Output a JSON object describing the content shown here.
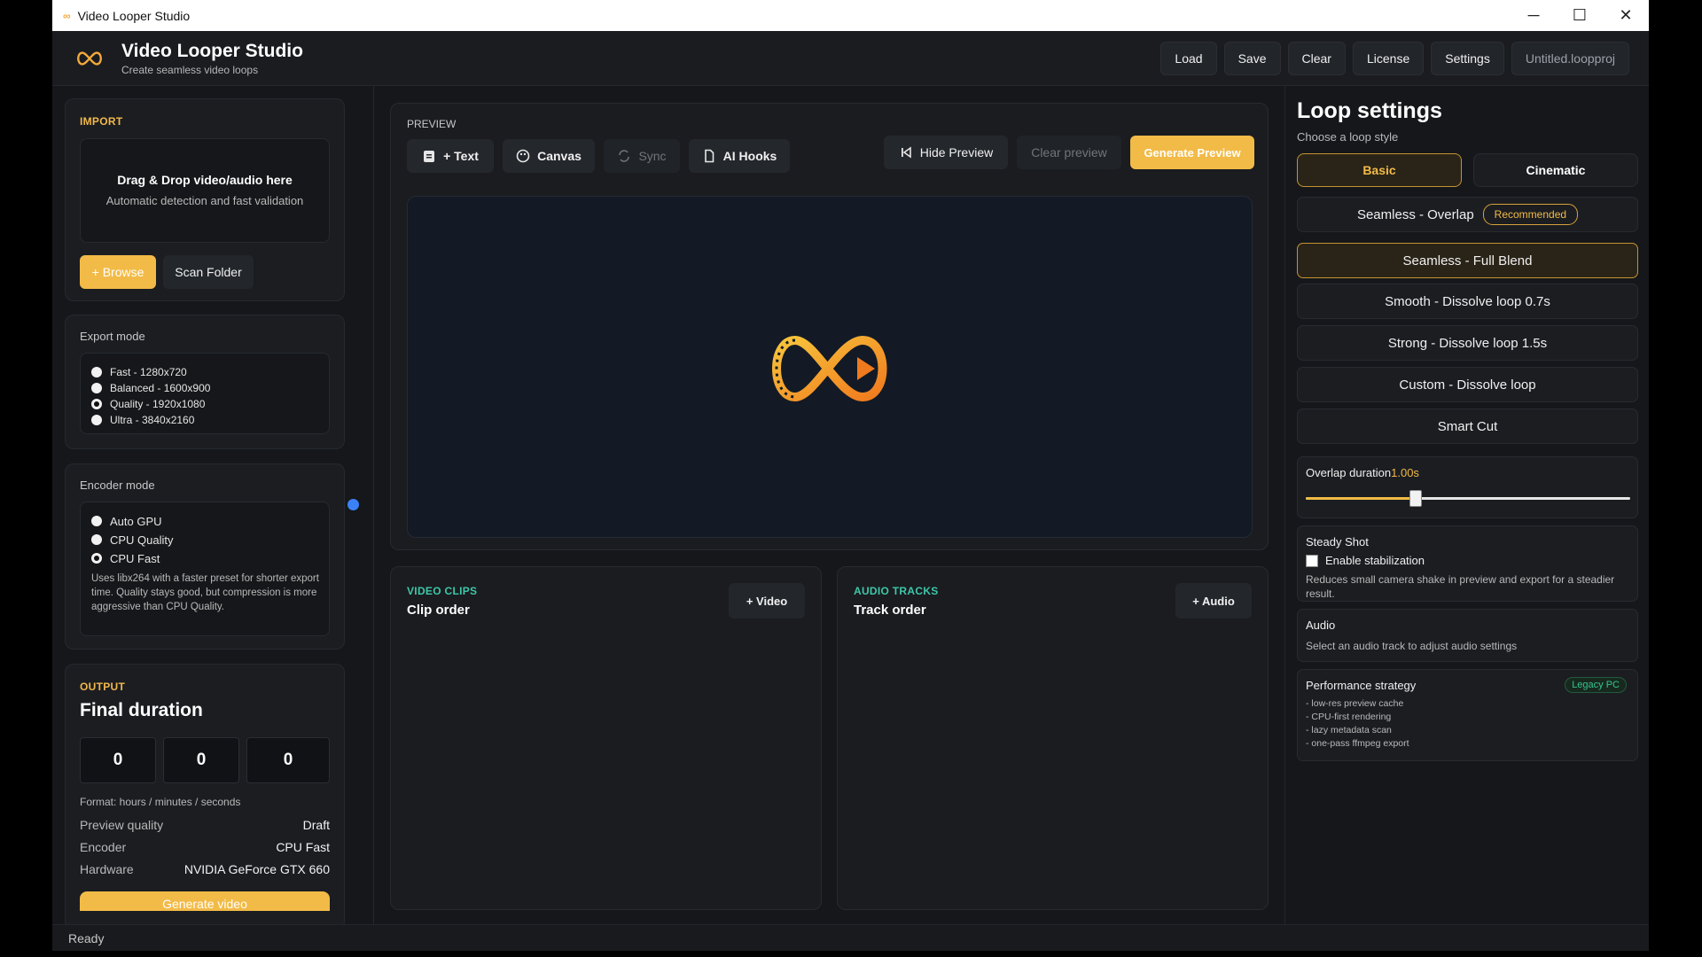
{
  "window": {
    "title": "Video Looper Studio",
    "app_icon": "loop-icon",
    "controls": [
      "minimize-icon",
      "maximize-icon",
      "close-icon"
    ]
  },
  "header": {
    "title": "Video Looper Studio",
    "subtitle": "Create seamless video loops",
    "buttons": {
      "load": "Load",
      "save": "Save",
      "clear": "Clear",
      "license": "License",
      "settings": "Settings"
    },
    "project_name": "Untitled.loopproj"
  },
  "import": {
    "label": "IMPORT",
    "drop_title": "Drag & Drop video/audio here",
    "drop_sub": "Automatic detection and fast validation",
    "browse": "+ Browse",
    "scan": "Scan Folder"
  },
  "export_mode": {
    "label": "Export mode",
    "options": [
      "Fast - 1280x720",
      "Balanced - 1600x900",
      "Quality - 1920x1080",
      "Ultra - 3840x2160"
    ],
    "selected": "Quality - 1920x1080"
  },
  "encoder_mode": {
    "label": "Encoder mode",
    "options": [
      "Auto GPU",
      "CPU Quality",
      "CPU Fast"
    ],
    "selected": "CPU Fast",
    "description": "Uses libx264 with a faster preset for shorter export time. Quality stays good, but compression is more aggressive than CPU Quality."
  },
  "output": {
    "label": "OUTPUT",
    "title": "Final duration",
    "hours": "0",
    "minutes": "0",
    "seconds": "0",
    "format_hint": "Format: hours / minutes / seconds",
    "rows": [
      {
        "key": "Preview quality",
        "value": "Draft"
      },
      {
        "key": "Encoder",
        "value": "CPU Fast"
      },
      {
        "key": "Hardware",
        "value": "NVIDIA GeForce GTX 660"
      }
    ],
    "generate": "Generate video"
  },
  "preview": {
    "label": "PREVIEW",
    "tools": {
      "text": "+ Text",
      "canvas": "Canvas",
      "sync": "Sync",
      "ai_hooks": "AI Hooks"
    },
    "hide": "Hide Preview",
    "clear": "Clear preview",
    "generate": "Generate Preview"
  },
  "video_clips": {
    "label": "VIDEO CLIPS",
    "title": "Clip order",
    "add": "+ Video"
  },
  "audio_tracks": {
    "label": "AUDIO TRACKS",
    "title": "Track order",
    "add": "+ Audio"
  },
  "loop_settings": {
    "title": "Loop settings",
    "subtitle": "Choose a loop style",
    "tabs": {
      "basic": "Basic",
      "cinematic": "Cinematic"
    },
    "active_tab": "Basic",
    "options": [
      {
        "label": "Seamless - Overlap",
        "badge": "Recommended"
      },
      {
        "label": "Seamless - Full Blend"
      },
      {
        "label": "Smooth - Dissolve loop 0.7s"
      },
      {
        "label": "Strong - Dissolve loop 1.5s"
      },
      {
        "label": "Custom - Dissolve loop"
      },
      {
        "label": "Smart Cut"
      }
    ],
    "selected": "Seamless - Full Blend",
    "overlap": {
      "label": "Overlap duration",
      "value": "1.00s",
      "slider_fraction": 0.34
    },
    "steady_shot": {
      "title": "Steady Shot",
      "checkbox": "Enable stabilization",
      "checked": false,
      "description": "Reduces small camera shake in preview and export for a steadier result."
    },
    "audio": {
      "title": "Audio",
      "description": "Select an audio track to adjust audio settings"
    },
    "performance": {
      "title": "Performance strategy",
      "badge": "Legacy PC",
      "items": [
        "- low-res preview cache",
        "- CPU-first rendering",
        "- lazy metadata scan",
        "- one-pass ffmpeg export"
      ]
    }
  },
  "status": {
    "text": "Ready"
  },
  "colors": {
    "accent": "#f2bb47",
    "teal": "#3ec7a8",
    "badge_green": "#35c48a",
    "slider_dot": "#3b82f6"
  }
}
